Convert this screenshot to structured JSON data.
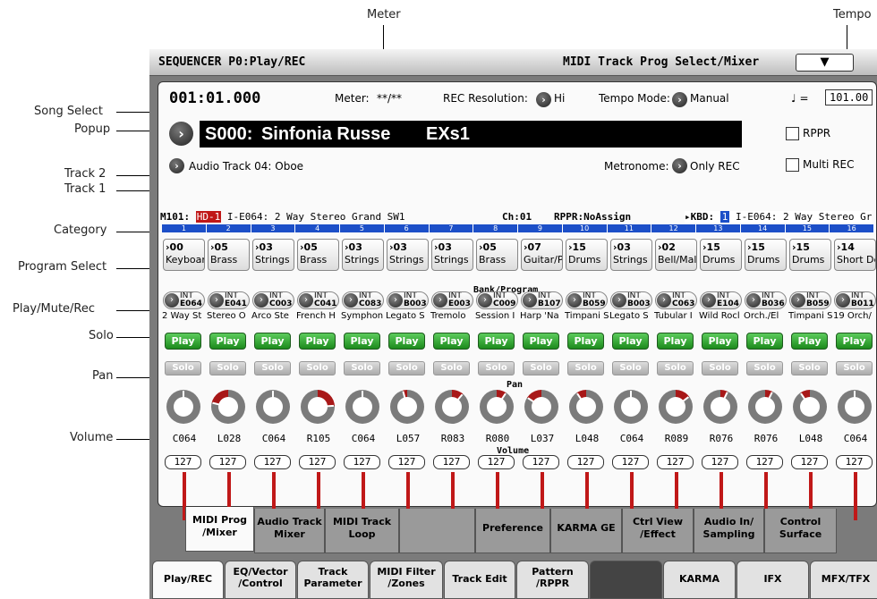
{
  "callouts": {
    "meter": "Meter",
    "tempo": "Tempo",
    "song_select": "Song Select",
    "popup": "Popup",
    "track2": "Track 2",
    "track1": "Track 1",
    "category": "Category",
    "program_select": "Program Select",
    "play_mute_rec": "Play/Mute/Rec",
    "solo": "Solo",
    "pan": "Pan",
    "volume": "Volume"
  },
  "title": {
    "left": "SEQUENCER P0:Play/REC",
    "right": "MIDI Track Prog Select/Mixer",
    "dropdown": "▼"
  },
  "position": "001:01.000",
  "meter": {
    "label": "Meter:",
    "value": "**/**"
  },
  "rec_res": {
    "label": "REC Resolution:",
    "value": "Hi"
  },
  "tempo_mode": {
    "label": "Tempo Mode:",
    "value": "Manual"
  },
  "tempo": {
    "note": "♩ =",
    "value": "101.00"
  },
  "song": {
    "id": "S000:",
    "name": "Sinfonia Russe",
    "suffix": "EXs1"
  },
  "rppr": "RPPR",
  "audio_track": "Audio Track 04: Oboe",
  "metronome": {
    "label": "Metronome:",
    "value": "Only REC"
  },
  "multi_rec": "Multi REC",
  "track_info": {
    "m": "M1",
    "t": "01:",
    "hd": "HD-1",
    "prog": "I-E064: 2 Way Stereo Grand SW1",
    "ch": "Ch:01",
    "rppr": "RPPR:NoAssign",
    "kbd": "KBD:",
    "kbd_num": "1",
    "kbd_prog": "I-E064: 2 Way Stereo Gr"
  },
  "section_labels": {
    "bank": "Bank/Program",
    "pan": "Pan",
    "volume": "Volume"
  },
  "tracks": [
    {
      "n": "1",
      "cat_no": "00",
      "cat": "Keyboar",
      "bank": "INT",
      "prog": "E064",
      "name": "2 Way St",
      "play": "Play",
      "solo": "Solo",
      "pan": "C064",
      "pan_val": 0,
      "vol": "127"
    },
    {
      "n": "2",
      "cat_no": "05",
      "cat": "Brass",
      "bank": "INT",
      "prog": "E041",
      "name": "Stereo O",
      "play": "Play",
      "solo": "Solo",
      "pan": "L028",
      "pan_val": -36,
      "vol": "127"
    },
    {
      "n": "3",
      "cat_no": "03",
      "cat": "Strings",
      "bank": "INT",
      "prog": "C003",
      "name": "Arco Ste",
      "play": "Play",
      "solo": "Solo",
      "pan": "C064",
      "pan_val": 0,
      "vol": "127"
    },
    {
      "n": "4",
      "cat_no": "05",
      "cat": "Brass",
      "bank": "INT",
      "prog": "C041",
      "name": "French H",
      "play": "Play",
      "solo": "Solo",
      "pan": "R105",
      "pan_val": 41,
      "vol": "127"
    },
    {
      "n": "5",
      "cat_no": "03",
      "cat": "Strings",
      "bank": "INT",
      "prog": "C083",
      "name": "Symphon",
      "play": "Play",
      "solo": "Solo",
      "pan": "C064",
      "pan_val": 0,
      "vol": "127"
    },
    {
      "n": "6",
      "cat_no": "03",
      "cat": "Strings",
      "bank": "INT",
      "prog": "B003",
      "name": "Legato S",
      "play": "Play",
      "solo": "Solo",
      "pan": "L057",
      "pan_val": -7,
      "vol": "127"
    },
    {
      "n": "7",
      "cat_no": "03",
      "cat": "Strings",
      "bank": "INT",
      "prog": "E003",
      "name": "Tremolo",
      "play": "Play",
      "solo": "Solo",
      "pan": "R083",
      "pan_val": 19,
      "vol": "127"
    },
    {
      "n": "8",
      "cat_no": "05",
      "cat": "Brass",
      "bank": "INT",
      "prog": "C009",
      "name": "Session I",
      "play": "Play",
      "solo": "Solo",
      "pan": "R080",
      "pan_val": 16,
      "vol": "127"
    },
    {
      "n": "9",
      "cat_no": "07",
      "cat": "Guitar/P",
      "bank": "INT",
      "prog": "B107",
      "name": "Harp 'Na",
      "play": "Play",
      "solo": "Solo",
      "pan": "L037",
      "pan_val": -27,
      "vol": "127"
    },
    {
      "n": "10",
      "cat_no": "15",
      "cat": "Drums",
      "bank": "INT",
      "prog": "B059",
      "name": "Timpani S",
      "play": "Play",
      "solo": "Solo",
      "pan": "L048",
      "pan_val": -16,
      "vol": "127"
    },
    {
      "n": "11",
      "cat_no": "03",
      "cat": "Strings",
      "bank": "INT",
      "prog": "B003",
      "name": "Legato S",
      "play": "Play",
      "solo": "Solo",
      "pan": "C064",
      "pan_val": 0,
      "vol": "127"
    },
    {
      "n": "12",
      "cat_no": "02",
      "cat": "Bell/Mal",
      "bank": "INT",
      "prog": "C063",
      "name": "Tubular I",
      "play": "Play",
      "solo": "Solo",
      "pan": "R089",
      "pan_val": 25,
      "vol": "127"
    },
    {
      "n": "13",
      "cat_no": "15",
      "cat": "Drums",
      "bank": "INT",
      "prog": "E104",
      "name": "Wild Rocl",
      "play": "Play",
      "solo": "Solo",
      "pan": "R076",
      "pan_val": 12,
      "vol": "127"
    },
    {
      "n": "14",
      "cat_no": "15",
      "cat": "Drums",
      "bank": "INT",
      "prog": "B036",
      "name": "Orch./El",
      "play": "Play",
      "solo": "Solo",
      "pan": "R076",
      "pan_val": 12,
      "vol": "127"
    },
    {
      "n": "15",
      "cat_no": "15",
      "cat": "Drums",
      "bank": "INT",
      "prog": "B059",
      "name": "Timpani S",
      "play": "Play",
      "solo": "Solo",
      "pan": "L048",
      "pan_val": -16,
      "vol": "127"
    },
    {
      "n": "16",
      "cat_no": "14",
      "cat": "Short De",
      "bank": "INT",
      "prog": "B011",
      "name": "19 Orch/",
      "play": "Play",
      "solo": "Solo",
      "pan": "C064",
      "pan_val": 0,
      "vol": "127"
    }
  ],
  "tabs_top": [
    {
      "l1": "MIDI Prog",
      "l2": "/Mixer",
      "active": true
    },
    {
      "l1": "Audio Track",
      "l2": "Mixer"
    },
    {
      "l1": "MIDI Track",
      "l2": "Loop"
    },
    {
      "l1": "",
      "l2": ""
    },
    {
      "l1": "Preference",
      "l2": ""
    },
    {
      "l1": "KARMA GE",
      "l2": ""
    },
    {
      "l1": "Ctrl View",
      "l2": "/Effect"
    },
    {
      "l1": "Audio In/",
      "l2": "Sampling"
    },
    {
      "l1": "Control",
      "l2": "Surface"
    }
  ],
  "tabs_bottom": [
    {
      "l1": "Play/REC",
      "l2": "",
      "active": true
    },
    {
      "l1": "EQ/Vector",
      "l2": "/Control"
    },
    {
      "l1": "Track",
      "l2": "Parameter"
    },
    {
      "l1": "MIDI Filter",
      "l2": "/Zones"
    },
    {
      "l1": "Track Edit",
      "l2": ""
    },
    {
      "l1": "Pattern",
      "l2": "/RPPR"
    },
    {
      "l1": "",
      "l2": "",
      "dark": true
    },
    {
      "l1": "KARMA",
      "l2": ""
    },
    {
      "l1": "IFX",
      "l2": ""
    },
    {
      "l1": "MFX/TFX",
      "l2": ""
    }
  ],
  "colors": {
    "accent": "#c01818",
    "play": "#2aa02a",
    "track_num": "#1c4fc8"
  }
}
